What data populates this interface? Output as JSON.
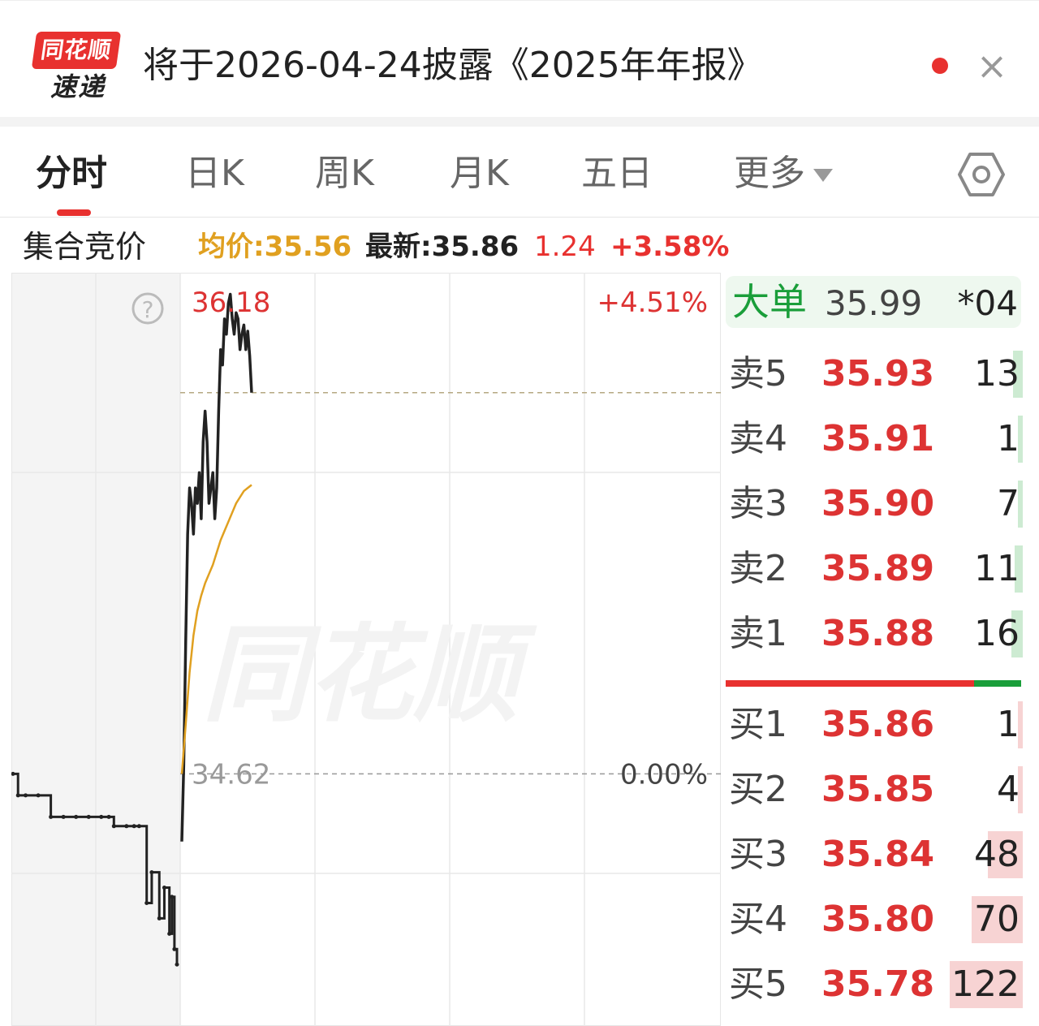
{
  "notification": {
    "logo_top": "同花顺",
    "logo_bottom": "速递",
    "title": "将于2026-04-24披露《2025年年报》",
    "close_symbol": "×"
  },
  "tabs": [
    {
      "label": "分时",
      "active": true
    },
    {
      "label": "日K"
    },
    {
      "label": "周K"
    },
    {
      "label": "月K"
    },
    {
      "label": "五日"
    },
    {
      "label": "更多"
    }
  ],
  "info": {
    "label": "集合竞价",
    "avg": "均价:35.56",
    "latest": "最新:35.86",
    "change": "1.24",
    "change_pct": "+3.58%"
  },
  "colors": {
    "up": "#e8312f",
    "down": "#1a9e3a",
    "avg_line": "#e0a020",
    "price_line": "#222222"
  },
  "chart_data": {
    "type": "line",
    "high_label": "36.18",
    "high_pct": "+4.51%",
    "base_label": "34.62",
    "base_pct": "0.00%",
    "help_symbol": "?",
    "watermark": "同花顺",
    "ylim": [
      33.8,
      36.25
    ],
    "auction_x": [
      0,
      2,
      5,
      10,
      15,
      20,
      25,
      30,
      35,
      38,
      40,
      45,
      48,
      50,
      53,
      55,
      58,
      60,
      62,
      63,
      64,
      65
    ],
    "auction_y": [
      34.62,
      34.55,
      34.55,
      34.55,
      34.48,
      34.48,
      34.48,
      34.48,
      34.48,
      34.48,
      34.45,
      34.45,
      34.45,
      34.45,
      34.2,
      34.3,
      34.15,
      34.25,
      34.1,
      34.22,
      34.05,
      34.0
    ],
    "price_x": [
      0,
      1,
      2,
      3,
      4,
      5,
      6,
      7,
      8,
      9,
      10,
      11,
      12,
      13,
      14,
      15,
      16,
      17,
      18,
      19,
      20,
      21,
      22,
      23,
      24,
      25,
      26,
      27,
      28,
      29,
      30,
      31,
      32,
      33,
      34,
      35,
      36
    ],
    "price_y": [
      34.4,
      34.65,
      35.05,
      35.4,
      35.55,
      35.5,
      35.4,
      35.55,
      35.5,
      35.6,
      35.45,
      35.7,
      35.8,
      35.7,
      35.5,
      35.55,
      35.6,
      35.45,
      35.55,
      35.8,
      36.0,
      35.95,
      36.1,
      36.05,
      36.15,
      36.18,
      36.1,
      36.05,
      36.12,
      36.1,
      36.0,
      36.05,
      36.08,
      36.0,
      36.06,
      35.98,
      35.86
    ],
    "avg_x": [
      0,
      2,
      4,
      6,
      8,
      10,
      12,
      14,
      16,
      18,
      20,
      22,
      24,
      26,
      28,
      30,
      32,
      34,
      36
    ],
    "avg_y": [
      34.62,
      34.78,
      34.95,
      35.07,
      35.15,
      35.2,
      35.24,
      35.27,
      35.3,
      35.34,
      35.38,
      35.41,
      35.44,
      35.47,
      35.5,
      35.52,
      35.54,
      35.55,
      35.56
    ]
  },
  "order_book": {
    "big_order": {
      "label": "大单",
      "price": "35.99",
      "volume": "*04"
    },
    "sells": [
      {
        "label": "卖5",
        "price": "35.93",
        "volume": "13",
        "depth": 0.13
      },
      {
        "label": "卖4",
        "price": "35.91",
        "volume": "1",
        "depth": 0.01
      },
      {
        "label": "卖3",
        "price": "35.90",
        "volume": "7",
        "depth": 0.07
      },
      {
        "label": "卖2",
        "price": "35.89",
        "volume": "11",
        "depth": 0.11
      },
      {
        "label": "卖1",
        "price": "35.88",
        "volume": "16",
        "depth": 0.16
      }
    ],
    "buys": [
      {
        "label": "买1",
        "price": "35.86",
        "volume": "1",
        "depth": 0.01
      },
      {
        "label": "买2",
        "price": "35.85",
        "volume": "4",
        "depth": 0.04
      },
      {
        "label": "买3",
        "price": "35.84",
        "volume": "48",
        "depth": 0.48
      },
      {
        "label": "买4",
        "price": "35.80",
        "volume": "70",
        "depth": 0.7
      },
      {
        "label": "买5",
        "price": "35.78",
        "volume": "122",
        "depth": 1.0
      }
    ]
  }
}
